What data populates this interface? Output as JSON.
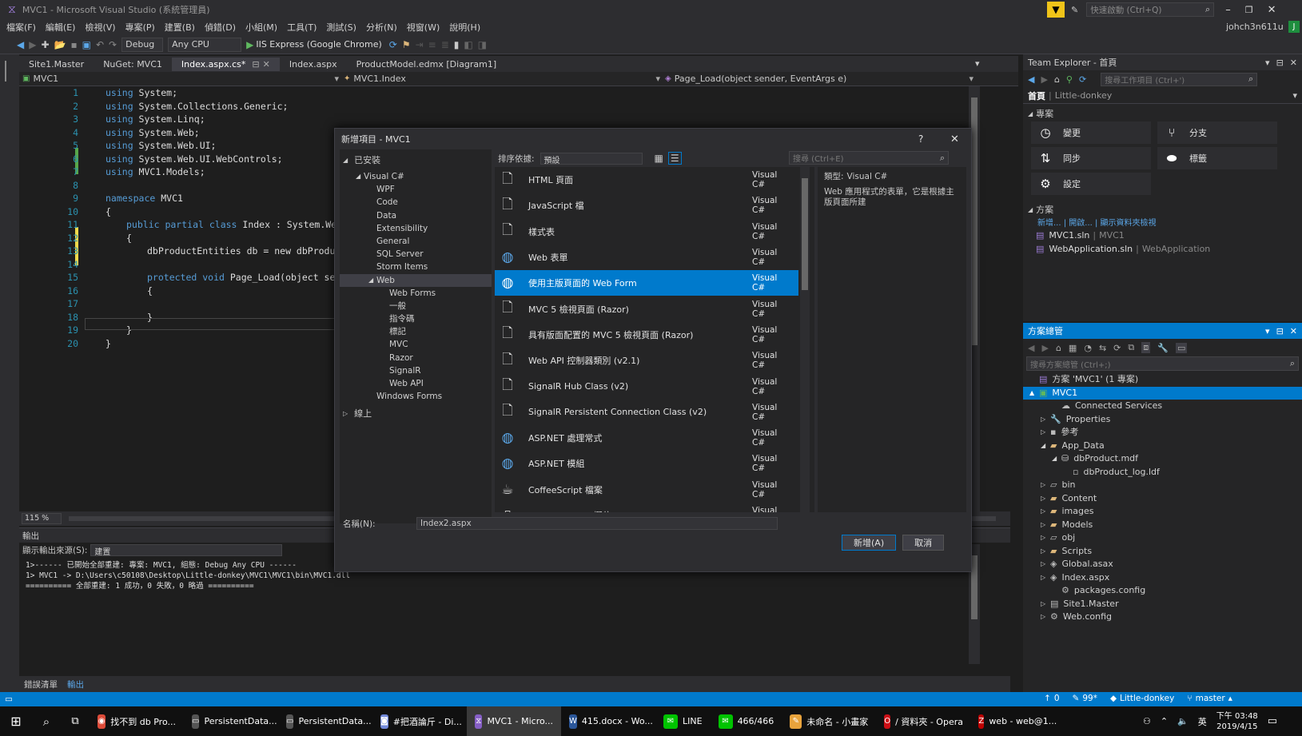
{
  "window": {
    "title": "MVC1 - Microsoft Visual Studio (系統管理員)",
    "quick_launch": "快速啟動 (Ctrl+Q)",
    "user": "johch3n611u",
    "user_initial": "J"
  },
  "menu": [
    "檔案(F)",
    "編輯(E)",
    "檢視(V)",
    "專案(P)",
    "建置(B)",
    "偵錯(D)",
    "小組(M)",
    "工具(T)",
    "測試(S)",
    "分析(N)",
    "視窗(W)",
    "說明(H)"
  ],
  "toolbar": {
    "config": "Debug",
    "platform": "Any CPU",
    "run_label": "IIS Express (Google Chrome)"
  },
  "tabs": [
    "Site1.Master",
    "NuGet: MVC1",
    "Index.aspx.cs*",
    "Index.aspx",
    "ProductModel.edmx [Diagram1]"
  ],
  "active_tab_index": 2,
  "nav": {
    "project": "MVC1",
    "class": "MVC1.Index",
    "member": "Page_Load(object sender, EventArgs e)"
  },
  "code_lines": [
    [
      "using",
      " System;"
    ],
    [
      "using",
      " System.Collections.Generic;"
    ],
    [
      "using",
      " System.Linq;"
    ],
    [
      "using",
      " System.Web;"
    ],
    [
      "using",
      " System.Web.UI;"
    ],
    [
      "using",
      " System.Web.UI.WebControls;"
    ],
    [
      "using",
      " MVC1.Models;"
    ],
    [
      "",
      ""
    ],
    [
      "namespace",
      " MVC1"
    ],
    [
      "",
      "{"
    ],
    [
      "public partial class",
      " Index : System.Web.UI.P"
    ],
    [
      "",
      "{"
    ],
    [
      "",
      "dbProductEntities db = new dbProductEnti"
    ],
    [
      "",
      ""
    ],
    [
      "protected void",
      " Page_Load(object sender,"
    ],
    [
      "",
      "{"
    ],
    [
      "",
      ""
    ],
    [
      "",
      "}"
    ],
    [
      "",
      "}"
    ],
    [
      "",
      "}"
    ]
  ],
  "editor": {
    "zoom": "115 %"
  },
  "output": {
    "title": "輸出",
    "source_label": "顯示輸出來源(S):",
    "source_value": "建置",
    "lines": [
      "1>------ 已開始全部重建: 專案: MVC1, 組態: Debug Any CPU ------",
      "1>  MVC1 -> D:\\Users\\c50108\\Desktop\\Little-donkey\\MVC1\\MVC1\\bin\\MVC1.dll",
      "========== 全部重建: 1 成功，0 失敗，0 略過 =========="
    ]
  },
  "bottom_tabs": [
    "錯誤清單",
    "輸出"
  ],
  "team_explorer": {
    "title": "Team Explorer - 首頁",
    "search": "搜尋工作項目 (Ctrl+')",
    "home": "首頁",
    "repo": "Little-donkey",
    "project_section": "專案",
    "tiles": [
      {
        "label": "變更",
        "icon": "clock-icon"
      },
      {
        "label": "分支",
        "icon": "branch-icon"
      },
      {
        "label": "同步",
        "icon": "sync-icon"
      },
      {
        "label": "標籤",
        "icon": "tag-icon"
      },
      {
        "label": "設定",
        "icon": "gear-icon"
      }
    ],
    "solutions_section": "方案",
    "solution_links": "新增... | 開啟... | 顯示資料夾檢視",
    "solutions": [
      {
        "name": "MVC1.sln",
        "path": "MVC1"
      },
      {
        "name": "WebApplication.sln",
        "path": "WebApplication"
      }
    ]
  },
  "solution_explorer": {
    "title": "方案總管",
    "search": "搜尋方案總管 (Ctrl+;)",
    "items": [
      {
        "label": "方案 'MVC1' (1 專案)",
        "indent": 0,
        "arrow": "",
        "icon": "solution-icon"
      },
      {
        "label": "MVC1",
        "indent": 0,
        "arrow": "▲",
        "icon": "project-icon",
        "selected": true
      },
      {
        "label": "Connected Services",
        "indent": 2,
        "arrow": "",
        "icon": "cloud-icon"
      },
      {
        "label": "Properties",
        "indent": 1,
        "arrow": "▷",
        "icon": "wrench-icon"
      },
      {
        "label": "參考",
        "indent": 1,
        "arrow": "▷",
        "icon": "ref-icon"
      },
      {
        "label": "App_Data",
        "indent": 1,
        "arrow": "◢",
        "icon": "folder-icon"
      },
      {
        "label": "dbProduct.mdf",
        "indent": 2,
        "arrow": "◢",
        "icon": "db-icon"
      },
      {
        "label": "dbProduct_log.ldf",
        "indent": 3,
        "arrow": "",
        "icon": "file-icon"
      },
      {
        "label": "bin",
        "indent": 1,
        "arrow": "▷",
        "icon": "folder-outline-icon"
      },
      {
        "label": "Content",
        "indent": 1,
        "arrow": "▷",
        "icon": "folder-icon"
      },
      {
        "label": "images",
        "indent": 1,
        "arrow": "▷",
        "icon": "folder-icon"
      },
      {
        "label": "Models",
        "indent": 1,
        "arrow": "▷",
        "icon": "folder-icon"
      },
      {
        "label": "obj",
        "indent": 1,
        "arrow": "▷",
        "icon": "folder-outline-icon"
      },
      {
        "label": "Scripts",
        "indent": 1,
        "arrow": "▷",
        "icon": "folder-icon"
      },
      {
        "label": "Global.asax",
        "indent": 1,
        "arrow": "▷",
        "icon": "asax-icon"
      },
      {
        "label": "Index.aspx",
        "indent": 1,
        "arrow": "▷",
        "icon": "aspx-icon"
      },
      {
        "label": "packages.config",
        "indent": 2,
        "arrow": "",
        "icon": "config-icon"
      },
      {
        "label": "Site1.Master",
        "indent": 1,
        "arrow": "▷",
        "icon": "master-icon"
      },
      {
        "label": "Web.config",
        "indent": 1,
        "arrow": "▷",
        "icon": "config-icon"
      }
    ]
  },
  "dialog": {
    "title": "新增項目 - MVC1",
    "installed": "已安裝",
    "online": "線上",
    "sort_label": "排序依據:",
    "sort_value": "預設",
    "search": "搜尋 (Ctrl+E)",
    "categories": [
      {
        "label": "Visual C#",
        "indent": 1,
        "arrow": "◢"
      },
      {
        "label": "WPF",
        "indent": 2,
        "arrow": ""
      },
      {
        "label": "Code",
        "indent": 2,
        "arrow": ""
      },
      {
        "label": "Data",
        "indent": 2,
        "arrow": ""
      },
      {
        "label": "Extensibility",
        "indent": 2,
        "arrow": ""
      },
      {
        "label": "General",
        "indent": 2,
        "arrow": ""
      },
      {
        "label": "SQL Server",
        "indent": 2,
        "arrow": ""
      },
      {
        "label": "Storm Items",
        "indent": 2,
        "arrow": ""
      },
      {
        "label": "Web",
        "indent": 2,
        "arrow": "◢",
        "selected": true
      },
      {
        "label": "Web Forms",
        "indent": 3,
        "arrow": ""
      },
      {
        "label": "一般",
        "indent": 3,
        "arrow": ""
      },
      {
        "label": "指令碼",
        "indent": 3,
        "arrow": ""
      },
      {
        "label": "標記",
        "indent": 3,
        "arrow": ""
      },
      {
        "label": "MVC",
        "indent": 3,
        "arrow": ""
      },
      {
        "label": "Razor",
        "indent": 3,
        "arrow": ""
      },
      {
        "label": "SignalR",
        "indent": 3,
        "arrow": ""
      },
      {
        "label": "Web API",
        "indent": 3,
        "arrow": ""
      },
      {
        "label": "Windows Forms",
        "indent": 2,
        "arrow": ""
      }
    ],
    "templates": [
      {
        "name": "HTML 頁面",
        "lang": "Visual C#",
        "icon": "html-file-icon"
      },
      {
        "name": "JavaScript 檔",
        "lang": "Visual C#",
        "icon": "js-file-icon"
      },
      {
        "name": "樣式表",
        "lang": "Visual C#",
        "icon": "css-file-icon"
      },
      {
        "name": "Web 表單",
        "lang": "Visual C#",
        "icon": "globe-icon"
      },
      {
        "name": "使用主版頁面的 Web Form",
        "lang": "Visual C#",
        "icon": "globe-icon",
        "selected": true
      },
      {
        "name": "MVC 5 檢視頁面 (Razor)",
        "lang": "Visual C#",
        "icon": "razor-file-icon"
      },
      {
        "name": "具有版面配置的 MVC 5 檢視頁面 (Razor)",
        "lang": "Visual C#",
        "icon": "razor-file-icon"
      },
      {
        "name": "Web API 控制器類別 (v2.1)",
        "lang": "Visual C#",
        "icon": "cs-file-icon"
      },
      {
        "name": "SignalR Hub Class (v2)",
        "lang": "Visual C#",
        "icon": "cs-file-icon"
      },
      {
        "name": "SignalR Persistent Connection Class (v2)",
        "lang": "Visual C#",
        "icon": "cs-file-icon"
      },
      {
        "name": "ASP.NET 處理常式",
        "lang": "Visual C#",
        "icon": "globe-file-icon"
      },
      {
        "name": "ASP.NET 模組",
        "lang": "Visual C#",
        "icon": "globe-file-icon"
      },
      {
        "name": "CoffeeScript 檔案",
        "lang": "Visual C#",
        "icon": "coffee-icon"
      },
      {
        "name": "Dynamic Data 欄位",
        "lang": "Visual C#",
        "icon": "data-field-icon"
      }
    ],
    "detail_type_label": "類型:",
    "detail_type": "Visual C#",
    "detail_desc": "Web 應用程式的表單，它是根據主版頁面所建",
    "name_label": "名稱(N):",
    "name_value": "Index2.aspx",
    "add_button": "新增(A)",
    "cancel_button": "取消"
  },
  "status": {
    "up": "0",
    "pending": "99*",
    "repo": "Little-donkey",
    "branch": "master"
  },
  "taskbar": {
    "items": [
      {
        "label": "找不到 db Pro...",
        "icon": "chrome-icon",
        "color": "#dd4b39"
      },
      {
        "label": "PersistentData...",
        "icon": "app-icon",
        "color": "#555"
      },
      {
        "label": "PersistentData...",
        "icon": "app-icon",
        "color": "#555"
      },
      {
        "label": "#把酒論斤 - Di...",
        "icon": "discord-icon",
        "color": "#7289da"
      },
      {
        "label": "MVC1 - Micro...",
        "icon": "vs-icon",
        "color": "#865fc5",
        "active": true
      },
      {
        "label": "415.docx - Wo...",
        "icon": "word-icon",
        "color": "#2b579a"
      },
      {
        "label": "LINE",
        "icon": "line-icon",
        "color": "#00c300"
      },
      {
        "label": "466/466",
        "icon": "line-icon",
        "color": "#00c300"
      },
      {
        "label": "未命名 - 小畫家",
        "icon": "paint-icon",
        "color": "#e8a33c"
      },
      {
        "label": "/ 資料夾 - Opera",
        "icon": "opera-icon",
        "color": "#cc0f16"
      },
      {
        "label": "web - web@1...",
        "icon": "filezilla-icon",
        "color": "#bf0000"
      }
    ],
    "time": "下午 03:48",
    "date": "2019/4/15",
    "ime": "英"
  }
}
